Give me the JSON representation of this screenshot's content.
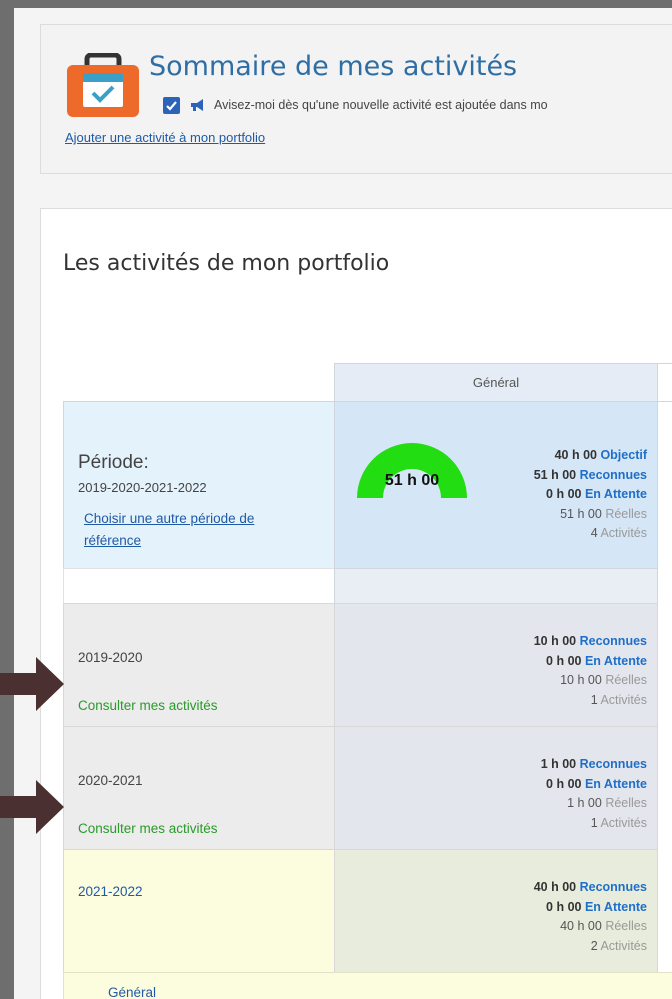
{
  "header": {
    "title": "Sommaire de mes activités",
    "notify_checked": true,
    "notify_text": "Avisez-moi dès qu'une nouvelle activité est ajoutée dans mo",
    "add_link": "Ajouter une activité à mon portfolio",
    "icon": "calendar-briefcase-icon"
  },
  "portfolio": {
    "section_title": "Les activités de mon portfolio",
    "column_header": "Général",
    "period": {
      "label": "Période:",
      "years": "2019-2020-2021-2022",
      "change_link": "Choisir une autre période de référence",
      "gauge_value": "51 h 00",
      "gauge_fill_fraction": 1.0,
      "gauge_color": "#22dd11",
      "stats": [
        {
          "value": "40 h 00",
          "label": "Objectif",
          "style": "blue"
        },
        {
          "value": "51 h 00",
          "label": "Reconnues",
          "style": "blue"
        },
        {
          "value": "0 h 00",
          "label": "En Attente",
          "style": "blue"
        },
        {
          "value": "51 h 00",
          "label": "Réelles",
          "style": "gray"
        },
        {
          "value": "4",
          "label": "Activités",
          "style": "gray"
        }
      ]
    },
    "years": [
      {
        "label": "2019-2020",
        "link": "Consulter mes activités",
        "stats": [
          {
            "value": "10 h 00",
            "label": "Reconnues"
          },
          {
            "value": "0 h 00",
            "label": "En Attente"
          },
          {
            "value": "10 h 00",
            "label": "Réelles"
          },
          {
            "value": "1",
            "label": "Activités"
          }
        ]
      },
      {
        "label": "2020-2021",
        "link": "Consulter mes activités",
        "stats": [
          {
            "value": "1 h 00",
            "label": "Reconnues"
          },
          {
            "value": "0 h 00",
            "label": "En Attente"
          },
          {
            "value": "1 h 00",
            "label": "Réelles"
          },
          {
            "value": "1",
            "label": "Activités"
          }
        ]
      },
      {
        "label": "2021-2022",
        "link": "",
        "stats": [
          {
            "value": "40 h 00",
            "label": "Reconnues"
          },
          {
            "value": "0 h 00",
            "label": "En Attente"
          },
          {
            "value": "40 h 00",
            "label": "Réelles"
          },
          {
            "value": "2",
            "label": "Activités"
          }
        ]
      }
    ],
    "footer_label": "Général"
  },
  "colors": {
    "accent_blue": "#1f5aa6",
    "green_link": "#2a9a2a",
    "arrow": "#4a3030"
  }
}
